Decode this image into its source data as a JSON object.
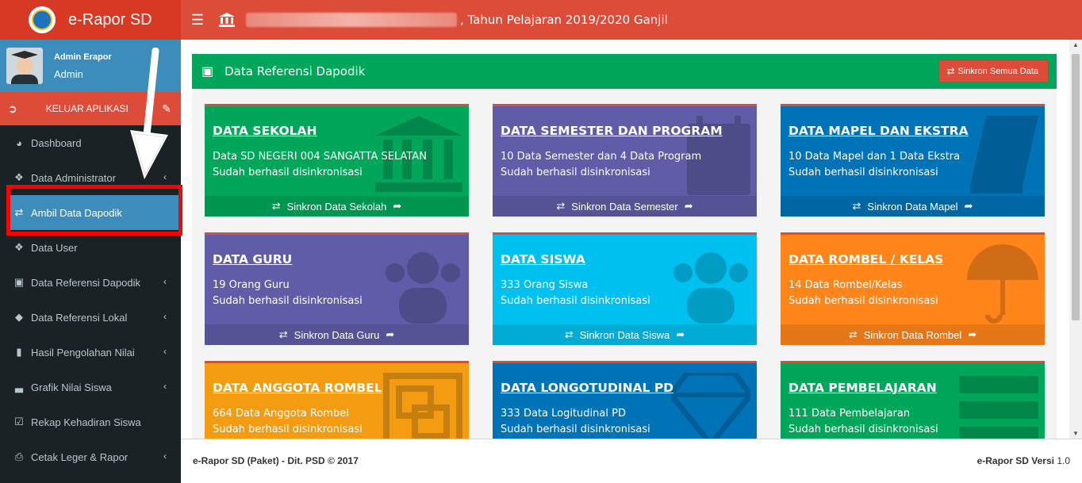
{
  "app": {
    "logo_text": "e-Rapor SD",
    "title_suffix": ", Tahun Pelajaran 2019/2020 Ganjil"
  },
  "user": {
    "name": "Admin Erapor",
    "role": "Admin"
  },
  "logout_label": "KELUAR APLIKASI",
  "menu": [
    {
      "label": "Dashboard",
      "icon": "dashboard-icon",
      "has_children": false
    },
    {
      "label": "Data Administrator",
      "icon": "users-icon",
      "has_children": true
    },
    {
      "label": "Ambil Data Dapodik",
      "icon": "shuffle-icon",
      "has_children": false,
      "active": true
    },
    {
      "label": "Data User",
      "icon": "users-icon",
      "has_children": false
    },
    {
      "label": "Data Referensi Dapodik",
      "icon": "desktop-icon",
      "has_children": true
    },
    {
      "label": "Data Referensi Lokal",
      "icon": "tags-icon",
      "has_children": true
    },
    {
      "label": "Hasil Pengolahan Nilai",
      "icon": "book-icon",
      "has_children": true
    },
    {
      "label": "Grafik Nilai Siswa",
      "icon": "bar-chart-icon",
      "has_children": true
    },
    {
      "label": "Rekap Kehadiran Siswa",
      "icon": "check-square-icon",
      "has_children": false
    },
    {
      "label": "Cetak Leger & Rapor",
      "icon": "print-icon",
      "has_children": true
    }
  ],
  "panel": {
    "title": "Data Referensi Dapodik",
    "sync_all_label": "Sinkron Semua Data"
  },
  "cards": [
    {
      "title": "DATA SEKOLAH",
      "line1": "Data SD NEGERI 004 SANGATTA SELATAN",
      "line2": "Sudah berhasil disinkronisasi",
      "action": "Sinkron Data Sekolah",
      "color": "#00a65a",
      "icon": "bank-icon"
    },
    {
      "title": "DATA SEMESTER DAN PROGRAM",
      "line1": "10 Data Semester dan 4 Data Program",
      "line2": "Sudah berhasil disinkronisasi",
      "action": "Sinkron Data Semester",
      "color": "#605ca8",
      "icon": "calendar-icon"
    },
    {
      "title": "DATA MAPEL DAN EKSTRA",
      "line1": "10 Data Mapel dan 1 Data Ekstra",
      "line2": "Sudah berhasil disinkronisasi",
      "action": "Sinkron Data Mapel",
      "color": "#0073b7",
      "icon": "book-icon"
    },
    {
      "title": "DATA GURU",
      "line1": "19 Orang Guru",
      "line2": "Sudah berhasil disinkronisasi",
      "action": "Sinkron Data Guru",
      "color": "#605ca8",
      "icon": "users-icon"
    },
    {
      "title": "DATA SISWA",
      "line1": "333 Orang Siswa",
      "line2": "Sudah berhasil disinkronisasi",
      "action": "Sinkron Data Siswa",
      "color": "#00c0ef",
      "icon": "users-icon"
    },
    {
      "title": "DATA ROMBEL / KELAS",
      "line1": "14 Data Rombel/Kelas",
      "line2": "Sudah berhasil disinkronisasi",
      "action": "Sinkron Data Rombel",
      "color": "#ff851b",
      "icon": "umbrella-icon"
    },
    {
      "title": "DATA ANGGOTA ROMBEL",
      "line1": "664 Data Anggota Rombel",
      "line2": "Sudah berhasil disinkronisasi",
      "action": "",
      "color": "#f39c12",
      "icon": "object-group-icon"
    },
    {
      "title": "DATA LONGOTUDINAL PD",
      "line1": "333 Data Logitudinal PD",
      "line2": "Sudah berhasil disinkronisasi",
      "action": "",
      "color": "#0073b7",
      "icon": "diamond-icon"
    },
    {
      "title": "DATA PEMBELAJARAN",
      "line1": "111 Data Pembelajaran",
      "line2": "Sudah berhasil disinkronisasi",
      "action": "",
      "color": "#00a65a",
      "icon": "server-icon"
    }
  ],
  "footer": {
    "left": "e-Rapor SD (Paket) - Dit. PSD © 2017",
    "right_bold": "e-Rapor SD Versi",
    "right_version": "1.0"
  }
}
